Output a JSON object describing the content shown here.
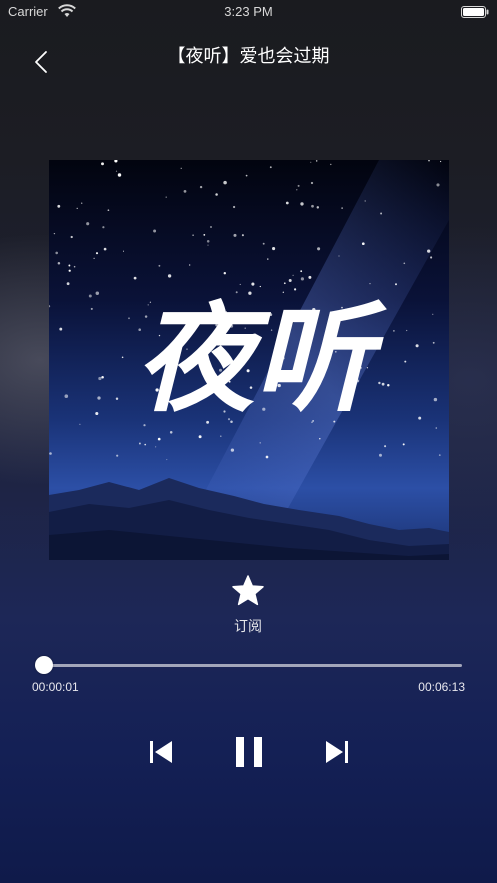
{
  "status_bar": {
    "carrier": "Carrier",
    "time": "3:23 PM",
    "wifi_icon": "wifi-icon",
    "battery_icon": "battery-icon"
  },
  "nav": {
    "back_icon": "chevron-left-icon",
    "title": "【夜听】爱也会过期"
  },
  "cover": {
    "text": "夜听"
  },
  "subscribe": {
    "icon": "star-icon",
    "label": "订阅"
  },
  "player": {
    "current_time": "00:00:01",
    "total_time": "00:06:13",
    "progress": 0.003
  },
  "controls": {
    "prev_icon": "skip-previous-icon",
    "pause_icon": "pause-icon",
    "next_icon": "skip-next-icon"
  },
  "colors": {
    "background_top": "#1a1b1f",
    "background_bottom": "#0f1a4a",
    "foreground": "#ffffff"
  }
}
